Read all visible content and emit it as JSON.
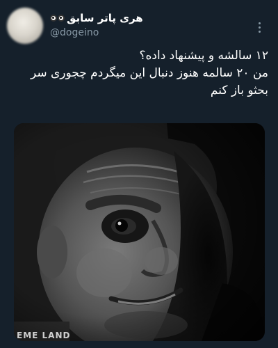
{
  "author": {
    "display_name": "هری پاتر سابق",
    "handle": "@dogeino"
  },
  "tweet": {
    "lines": [
      "۱۲ سالشه و پیشنهاد داده؟",
      "من ۲۰ سالمه هنوز دنبال این میگردم چجوری سر",
      "بحثو باز کنم"
    ]
  },
  "media": {
    "description_icon": "meme-face-image",
    "overlay_text": "EME LAND"
  },
  "icons": {
    "more": "more-vertical-icon",
    "eyes": "eyes-emoji-icon"
  },
  "colors": {
    "background": "#15202b",
    "text": "#ffffff",
    "secondary": "#8899a6"
  }
}
